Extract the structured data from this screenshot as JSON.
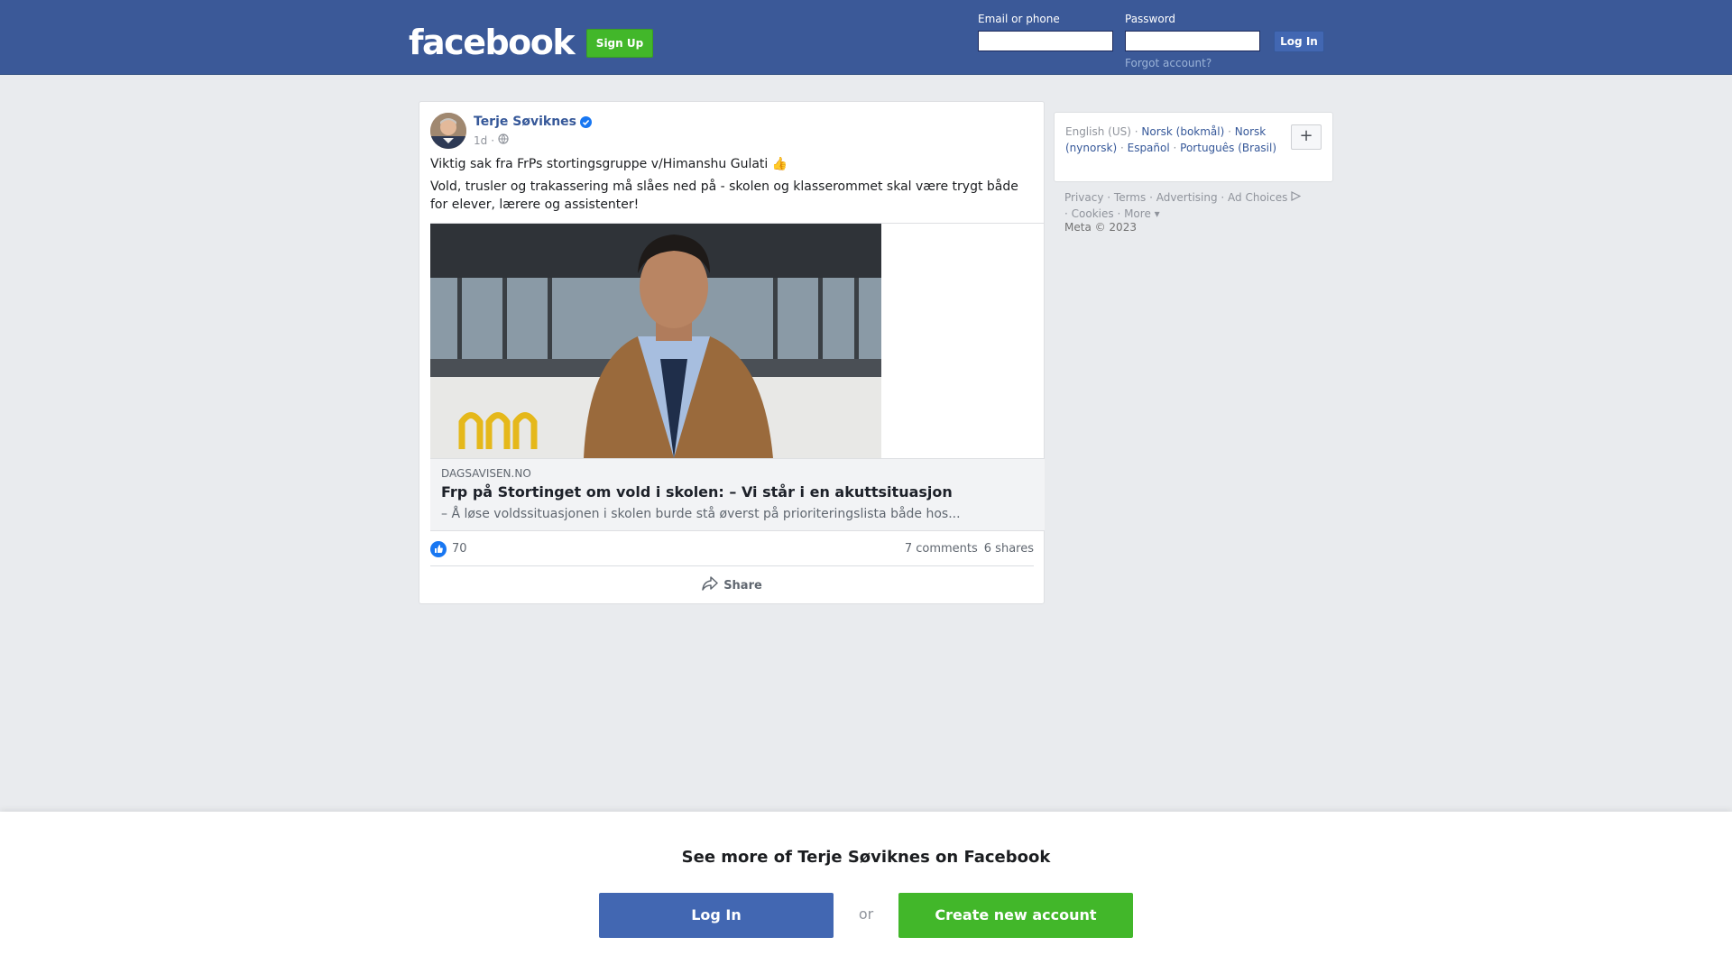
{
  "header": {
    "logo": "facebook",
    "signup_label": "Sign Up",
    "email_label": "Email or phone",
    "password_label": "Password",
    "login_label": "Log In",
    "forgot_label": "Forgot account?",
    "bg_color": "#3b5998"
  },
  "post": {
    "author": "Terje Søviknes",
    "verified": true,
    "time": "1d",
    "visibility_icon": "globe-icon",
    "text_line1": "Viktig sak fra FrPs stortingsgruppe v/Himanshu Gulati 👍",
    "text_line2": "Vold, trusler og trakassering må slåes ned på - skolen og klasserommet skal være trygt både for elever, lærere og assistenter!",
    "link": {
      "domain": "DAGSAVISEN.NO",
      "title": "Frp på Stortinget om vold i skolen: – Vi står i en akuttsituasjon",
      "description": "– Å løse voldssituasjonen i skolen burde stå øverst på prioriteringslista både hos..."
    },
    "likes": "70",
    "comments": "7 comments",
    "shares": "6 shares",
    "share_label": "Share"
  },
  "sidebar": {
    "current_language": "English (US)",
    "languages": [
      "Norsk (bokmål)",
      "Norsk (nynorsk)",
      "Español",
      "Português (Brasil)"
    ],
    "add_label": "+",
    "footer": [
      "Privacy",
      "Terms",
      "Advertising",
      "Ad Choices",
      "Cookies",
      "More"
    ],
    "copyright": "Meta © 2023"
  },
  "banner": {
    "title": "See more of Terje Søviknes on Facebook",
    "login_label": "Log In",
    "or_label": "or",
    "create_label": "Create new account"
  },
  "colors": {
    "brand_blue": "#4267b2",
    "signup_green": "#42b72a",
    "link_blue": "#365899"
  }
}
